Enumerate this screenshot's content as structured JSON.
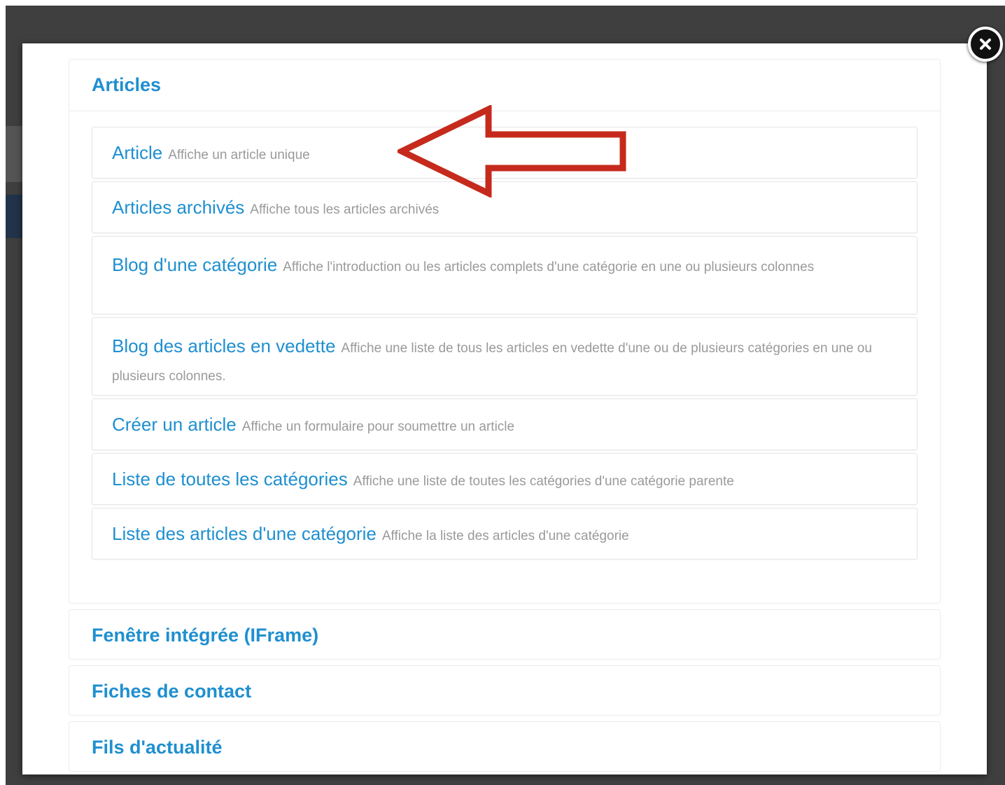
{
  "modal": {
    "close_icon": "close-icon",
    "accent_color": "#1f8fcf",
    "arrow_color": "#c52a1c"
  },
  "sections": [
    {
      "title": "Articles",
      "expanded": true,
      "items": [
        {
          "title": "Article",
          "description": "Affiche un article unique"
        },
        {
          "title": "Articles archivés",
          "description": "Affiche tous les articles archivés"
        },
        {
          "title": "Blog d'une catégorie",
          "description": "Affiche l'introduction ou les articles complets d'une catégorie en une ou plusieurs colonnes"
        },
        {
          "title": "Blog des articles en vedette",
          "description": "Affiche une liste de tous les articles en vedette d'une ou de plusieurs catégories en une ou plusieurs colonnes."
        },
        {
          "title": "Créer un article",
          "description": "Affiche un formulaire pour soumettre un article"
        },
        {
          "title": "Liste de toutes les catégories",
          "description": "Affiche une liste de toutes les catégories d'une catégorie parente"
        },
        {
          "title": "Liste des articles d'une catégorie",
          "description": "Affiche la liste des articles d'une catégorie"
        }
      ]
    },
    {
      "title": "Fenêtre intégrée (IFrame)",
      "expanded": false
    },
    {
      "title": "Fiches de contact",
      "expanded": false
    },
    {
      "title": "Fils d'actualité",
      "expanded": false
    }
  ]
}
